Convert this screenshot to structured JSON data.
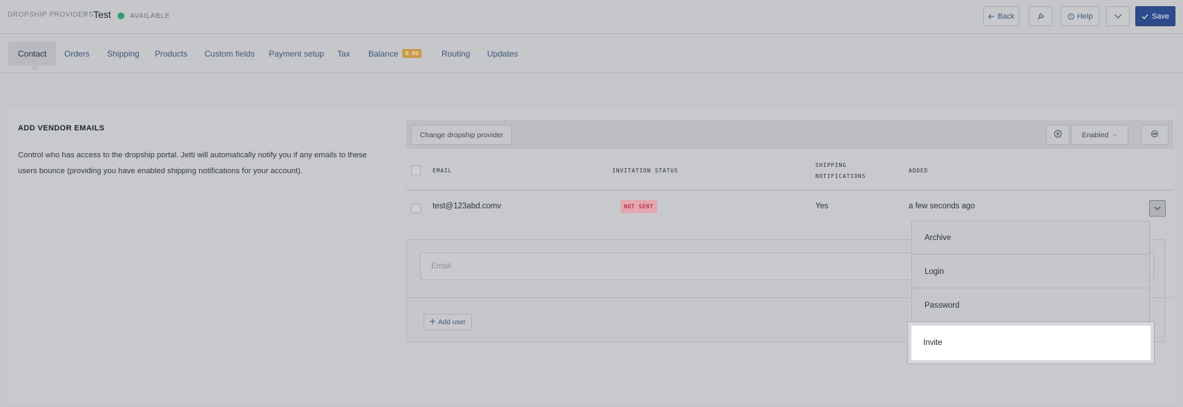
{
  "header": {
    "breadcrumb": "DROPSHIP PROVIDERS",
    "separator": "/",
    "title": "Test",
    "status": "AVAILABLE",
    "status_color": "#3a9a6e",
    "back_label": "Back",
    "help_label": "Help",
    "save_label": "Save",
    "save_color": "#2c4b8a"
  },
  "tabs": [
    {
      "label": "Contact",
      "active": true
    },
    {
      "label": "Orders"
    },
    {
      "label": "Shipping"
    },
    {
      "label": "Products"
    },
    {
      "label": "Custom fields"
    },
    {
      "label": "Payment setup"
    },
    {
      "label": "Tax"
    },
    {
      "label": "Balance",
      "badge": "0.00"
    },
    {
      "label": "Routing"
    },
    {
      "label": "Updates"
    }
  ],
  "section": {
    "title": "ADD VENDOR EMAILS",
    "description": "Control who has access to the dropship portal. Jetti will automatically notify you if any emails to these users bounce (providing you have enabled shipping notifications for your account)."
  },
  "toolbar": {
    "change_label": "Change dropship provider",
    "filter_label": "Enabled"
  },
  "table": {
    "columns": {
      "email": "EMAIL",
      "invitation_status": "INVITATION STATUS",
      "shipping_notifications_line1": "SHIPPING",
      "shipping_notifications_line2": "NOTIFICATIONS",
      "added": "ADDED"
    },
    "rows": [
      {
        "email": "test@123abd.comv",
        "invitation_status": "NOT SENT",
        "shipping_notifications": "Yes",
        "added": "a few seconds ago"
      }
    ]
  },
  "form": {
    "email_placeholder": "Email",
    "add_user_label": "Add user"
  },
  "row_menu": {
    "items": [
      "Archive",
      "Login",
      "Password",
      "Invite"
    ],
    "highlighted": "Invite"
  },
  "icons": {
    "back": "arrow-left-icon",
    "tool": "wrench-icon",
    "help": "help-circle-icon",
    "more": "chevron-down-icon",
    "save": "check-icon",
    "clear": "close-circle-icon",
    "settings": "settings-icon",
    "add": "plus-icon"
  }
}
